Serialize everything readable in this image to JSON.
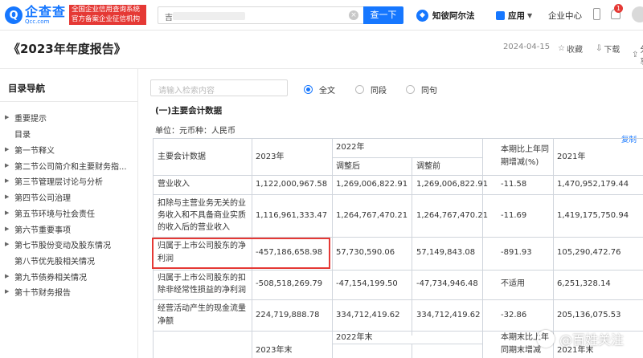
{
  "header": {
    "logo_cn": "企查查",
    "logo_en": "Qcc.com",
    "slogan_line1": "全国企业信用查询系统",
    "slogan_line2": "官方备案企业征信机构",
    "search_value": "吉",
    "search_button": "查一下",
    "zhibo_label": "知彼阿尔法",
    "app_label": "应用",
    "enterprise_center": "企业中心",
    "notification_count": "1"
  },
  "titlebar": {
    "title": "《2023年年度报告》",
    "date": "2024-04-15",
    "favorite": "收藏",
    "download": "下载",
    "share": "分享"
  },
  "sidebar": {
    "title": "目录导航",
    "items": [
      {
        "label": "重要提示",
        "arrow": true
      },
      {
        "label": "目录",
        "arrow": false
      },
      {
        "label": "第一节释义",
        "arrow": true
      },
      {
        "label": "第二节公司简介和主要财务指...",
        "arrow": true
      },
      {
        "label": "第三节管理层讨论与分析",
        "arrow": true
      },
      {
        "label": "第四节公司治理",
        "arrow": true
      },
      {
        "label": "第五节环境与社会责任",
        "arrow": true
      },
      {
        "label": "第六节重要事项",
        "arrow": true
      },
      {
        "label": "第七节股份变动及股东情况",
        "arrow": true
      },
      {
        "label": "第八节优先股相关情况",
        "arrow": false
      },
      {
        "label": "第九节债券相关情况",
        "arrow": true
      },
      {
        "label": "第十节财务报告",
        "arrow": true
      }
    ]
  },
  "main": {
    "search_placeholder": "请输入检索内容",
    "radio_options": [
      "全文",
      "同段",
      "同句"
    ],
    "radio_selected": "全文",
    "section_title": "(一)主要会计数据",
    "unit": "单位：元币种：人民币",
    "copy_label": "复制"
  },
  "table": {
    "header": {
      "col1": "主要会计数据",
      "col2": "2023年",
      "col3_group": "2022年",
      "col3a": "调整后",
      "col3b": "调整前",
      "col4_line1": "本期比上年同",
      "col4_line2": "期增减(%)",
      "col5": "2021年"
    },
    "rows": [
      {
        "item": [
          "营业收入"
        ],
        "y2023": "1,122,000,967.58",
        "adjusted": "1,269,006,822.91",
        "before": "1,269,006,822.91",
        "change": "-11.58",
        "y2021": "1,470,952,179.44"
      },
      {
        "item": [
          "扣除与主营业务无关的业",
          "务收入和不具备商业实质",
          "的收入后的营业收入"
        ],
        "y2023": "1,116,961,333.47",
        "adjusted": "1,264,767,470.21",
        "before": "1,264,767,470.21",
        "change": "-11.69",
        "y2021": "1,419,175,750.94"
      },
      {
        "item": [
          "归属于上市公司股东的净",
          "利润"
        ],
        "y2023": "-457,186,658.98",
        "adjusted": "57,730,590.06",
        "before": "57,149,843.08",
        "change": "-891.93",
        "y2021": "105,290,472.76"
      },
      {
        "item": [
          "归属于上市公司股东的扣",
          "除非经常性损益的净利润"
        ],
        "y2023": "-508,518,269.79",
        "adjusted": "-47,154,199.50",
        "before": "-47,734,946.48",
        "change": "不适用",
        "y2021": "6,251,328.14"
      },
      {
        "item": [
          "经营活动产生的现金流量",
          "净额"
        ],
        "y2023": "224,719,888.78",
        "adjusted": "334,712,419.62",
        "before": "334,712,419.62",
        "change": "-32.86",
        "y2021": "205,136,075.53"
      }
    ],
    "header2": {
      "col2": "2023年末",
      "col3_group": "2022年末",
      "col4_line1": "本期末比上年",
      "col4_line2": "同期末增减",
      "col5": "2021年末"
    }
  },
  "watermark": "@百姓关注"
}
